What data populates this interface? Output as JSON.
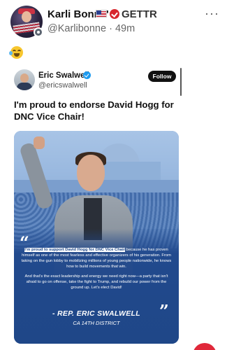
{
  "post": {
    "author_name": "Karli Bonne'",
    "platform_label": "GETTR",
    "handle": "@Karlibonne",
    "time": "· 49m",
    "emoji_icon": "rolling-on-floor-laughing-emoji"
  },
  "embed": {
    "author_name": "Eric Swalwell",
    "handle": "@ericswalwell",
    "follow_label": "Follow",
    "text": "I'm proud to endorse David Hogg for DNC Vice Chair!",
    "card": {
      "quote_highlight": "I'm proud to support David Hogg for DNC Vice Chair",
      "quote_part1": " because he has proven himself as one of the most fearless and effective organizers of his generation. From taking on the gun lobby to mobilizing millions of young people nationwide, he knows how to build movements that win.",
      "quote_part2": "And that's the exact leadership and energy we need right now—a party that isn't afraid to go on offense, take the fight to Trump, and rebuild our power from the ground up. Let's elect David!",
      "signature": "- REP. ERIC SWALWELL",
      "district": "CA 14TH DISTRICT"
    }
  },
  "colors": {
    "card_blue": "#1f4788",
    "follow_bg": "#111111",
    "verified_blue": "#1d9bf0",
    "gettr_red": "#d8272e"
  }
}
